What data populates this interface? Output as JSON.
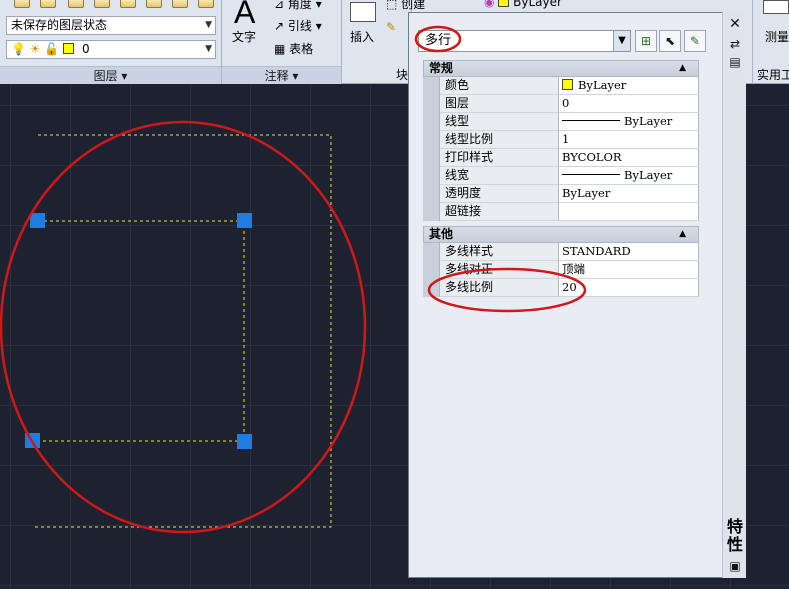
{
  "ribbon": {
    "layer_state": "未保存的图层状态",
    "layer_value": "0",
    "layer_panel_title": "图层",
    "text_label": "文字",
    "angle_label": "角度",
    "leader_label": "引线",
    "table_label": "表格",
    "annotation_panel_title": "注释",
    "create_label": "创建",
    "insert_label": "插入",
    "block_panel_title_partial": "块",
    "color_value": "ByLayer",
    "measure_label": "测量",
    "utilities_title_partial": "实用工"
  },
  "palette": {
    "object_type": "多行",
    "side_title": "特性",
    "general": {
      "title": "常规",
      "rows": [
        {
          "name": "颜色",
          "value": "ByLayer"
        },
        {
          "name": "图层",
          "value": "0"
        },
        {
          "name": "线型",
          "value": "ByLayer"
        },
        {
          "name": "线型比例",
          "value": "1"
        },
        {
          "name": "打印样式",
          "value": "BYCOLOR"
        },
        {
          "name": "线宽",
          "value": "ByLayer"
        },
        {
          "name": "透明度",
          "value": "ByLayer"
        },
        {
          "name": "超链接",
          "value": ""
        }
      ]
    },
    "misc": {
      "title": "其他",
      "rows": [
        {
          "name": "多线样式",
          "value": "STANDARD"
        },
        {
          "name": "多线对正",
          "value": "顶端"
        },
        {
          "name": "多线比例",
          "value": "20"
        }
      ]
    }
  },
  "colors": {
    "annotation_red": "#d01818",
    "grip_blue": "#1e7de0",
    "multiline_yellow": "#e5e34a",
    "canvas_bg": "#1e2230"
  }
}
